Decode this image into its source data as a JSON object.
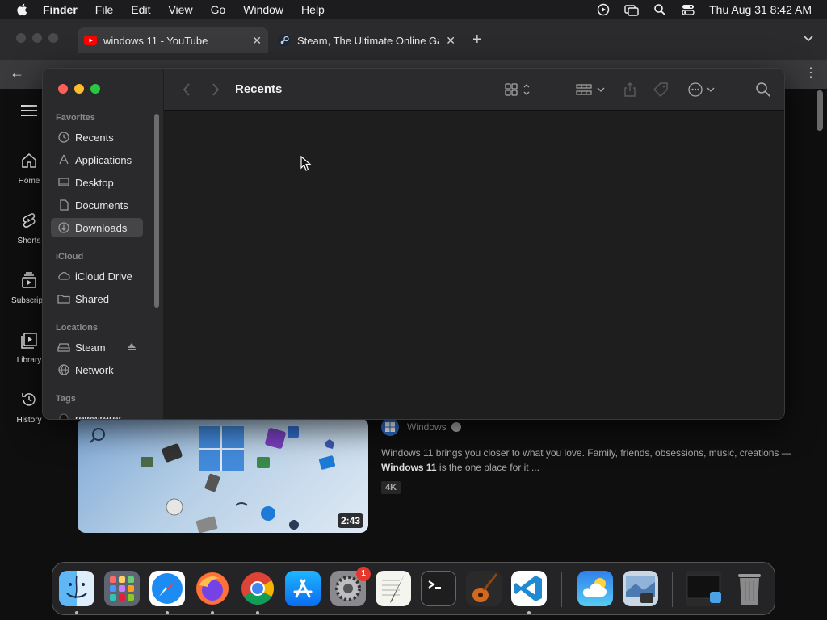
{
  "menubar": {
    "app_name": "Finder",
    "items": [
      "File",
      "Edit",
      "View",
      "Go",
      "Window",
      "Help"
    ],
    "clock": "Thu Aug 31  8:42 AM"
  },
  "browser": {
    "tabs": [
      {
        "title": "windows 11 - YouTube",
        "icon": "youtube-icon"
      },
      {
        "title": "Steam, The Ultimate Online Ga",
        "icon": "steam-icon"
      }
    ]
  },
  "youtube": {
    "nav": [
      {
        "label": "Home",
        "icon": "home-icon"
      },
      {
        "label": "Shorts",
        "icon": "shorts-icon"
      },
      {
        "label": "Subscripti",
        "icon": "subscriptions-icon"
      },
      {
        "label": "Library",
        "icon": "library-icon"
      },
      {
        "label": "History",
        "icon": "history-icon"
      }
    ],
    "video": {
      "duration": "2:43",
      "channel": "Windows",
      "description_line1": "Windows 11 brings you closer to what you love. Family, friends, obsessions, music, creations —",
      "description_bold": "Windows 11",
      "description_line2_rest": " is the one place for it ...",
      "badge": "4K"
    }
  },
  "finder": {
    "title": "Recents",
    "sidebar": {
      "favorites_header": "Favorites",
      "favorites": [
        {
          "label": "Recents",
          "icon": "clock-icon"
        },
        {
          "label": "Applications",
          "icon": "applications-icon"
        },
        {
          "label": "Desktop",
          "icon": "desktop-icon"
        },
        {
          "label": "Documents",
          "icon": "document-icon"
        },
        {
          "label": "Downloads",
          "icon": "download-icon",
          "selected": true
        }
      ],
      "icloud_header": "iCloud",
      "icloud": [
        {
          "label": "iCloud Drive",
          "icon": "cloud-icon"
        },
        {
          "label": "Shared",
          "icon": "shared-folder-icon"
        }
      ],
      "locations_header": "Locations",
      "locations": [
        {
          "label": "Steam",
          "icon": "drive-icon"
        },
        {
          "label": "Network",
          "icon": "network-icon"
        }
      ],
      "tags_header": "Tags",
      "tags": [
        {
          "label": "rewwrerer"
        }
      ]
    }
  },
  "dock": {
    "apps": [
      "finder",
      "launchpad",
      "safari",
      "firefox",
      "chrome",
      "app-store",
      "system-settings",
      "textedit",
      "terminal",
      "garageband",
      "vscode",
      "weather",
      "preview",
      "downloads-stack",
      "trash"
    ],
    "system_settings_badge": "1"
  }
}
